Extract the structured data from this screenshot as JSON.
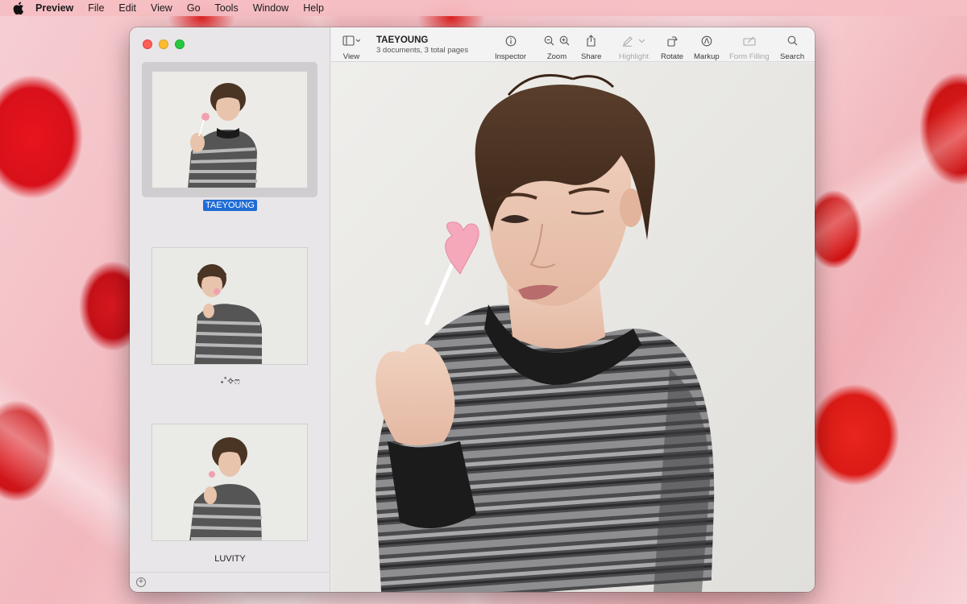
{
  "menubar": {
    "app_name": "Preview",
    "items": [
      "File",
      "Edit",
      "View",
      "Go",
      "Tools",
      "Window",
      "Help"
    ]
  },
  "window": {
    "title": "TAEYOUNG",
    "subtitle": "3 documents, 3 total pages"
  },
  "toolbar": {
    "view_label": "View",
    "inspector_label": "Inspector",
    "zoom_label": "Zoom",
    "share_label": "Share",
    "highlight_label": "Highlight",
    "rotate_label": "Rotate",
    "markup_label": "Markup",
    "form_filling_label": "Form Filling",
    "search_label": "Search"
  },
  "sidebar": {
    "thumbnails": [
      {
        "label": "TAEYOUNG",
        "selected": true
      },
      {
        "label": "⋆˚✧ෆ",
        "selected": false
      },
      {
        "label": "LUVITY",
        "selected": false
      }
    ]
  },
  "colors": {
    "selection_blue": "#1f6cd6",
    "traffic_red": "#fe5f57",
    "traffic_yellow": "#febc2e",
    "traffic_green": "#28c840"
  }
}
